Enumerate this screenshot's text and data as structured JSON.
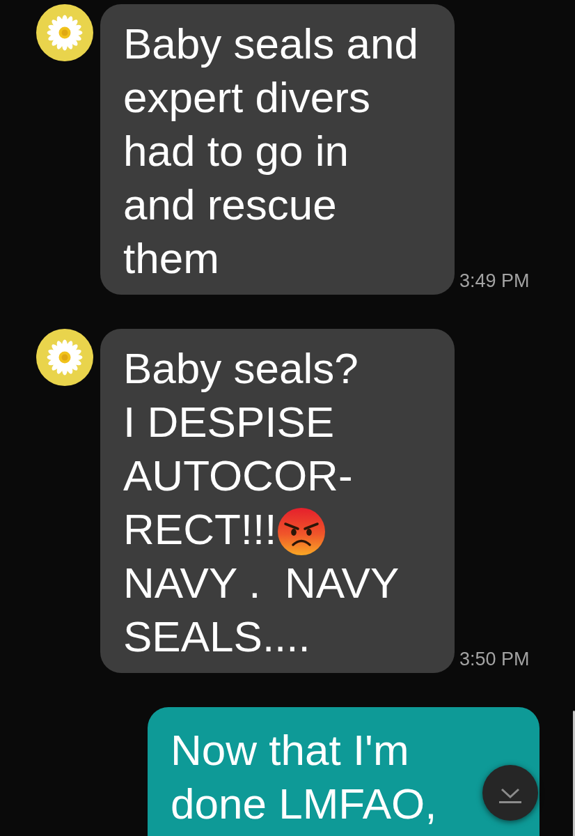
{
  "messages": [
    {
      "kind": "received",
      "parts": [
        {
          "kind": "text",
          "text": "Baby seals and\nexpert divers\nhad to go in\nand rescue\nthem",
          "emoji_after": false
        }
      ],
      "time": "3:49 PM"
    },
    {
      "kind": "received",
      "parts": [
        {
          "kind": "text",
          "text": "Baby seals?\nI DESPISE\nAUTOCOR-",
          "emoji_after": false
        },
        {
          "kind": "text",
          "text": "RECT!!!",
          "emoji_after": true
        },
        {
          "kind": "text",
          "text": "NAVY .  NAVY\nSEALS....",
          "emoji_after": false
        }
      ],
      "time": "3:50 PM"
    },
    {
      "kind": "sent",
      "parts": [
        {
          "kind": "text",
          "text": "Now that I'm\ndone LMFAO,",
          "emoji_after": false
        }
      ]
    }
  ]
}
